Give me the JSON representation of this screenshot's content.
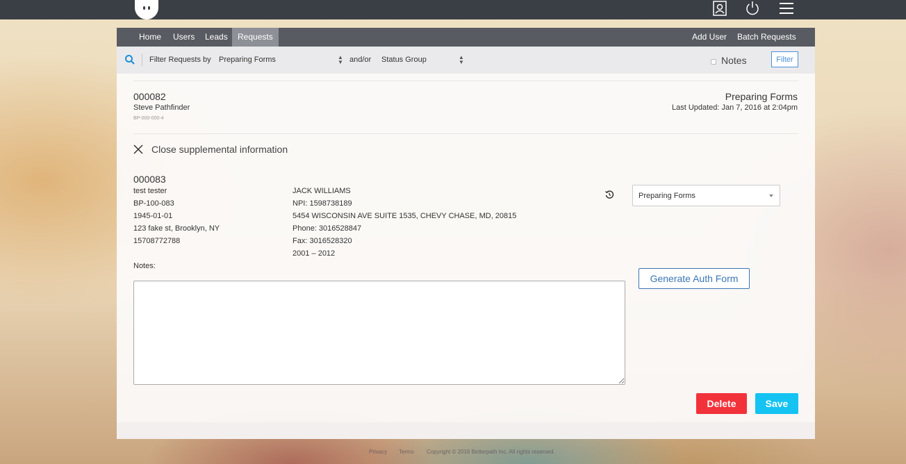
{
  "topbar": {
    "icons": [
      "logo-icon",
      "contact-card-icon",
      "power-icon",
      "menu-icon"
    ]
  },
  "nav": {
    "items": [
      "Home",
      "Users",
      "Leads",
      "Requests"
    ],
    "active": "Requests",
    "add_user": "Add User",
    "batch_requests": "Batch Requests"
  },
  "filter": {
    "label": "Filter Requests by",
    "request_status": "Preparing Forms",
    "andor": "and/or",
    "status_group": "Status Group",
    "notes_label": "Notes",
    "notes_checked": false,
    "filter_button": "Filter"
  },
  "request_summary": {
    "id": "000082",
    "name": "Steve Pathfinder",
    "code": "BP-000-000-4",
    "status": "Preparing Forms",
    "last_updated": "Last Updated: Jan 7, 2016 at 2:04pm"
  },
  "supplemental": {
    "close_label": "Close supplemental information",
    "id": "000083",
    "patient": {
      "name": "test tester",
      "code": "BP-100-083",
      "dob": "1945-01-01",
      "address": "123 fake st, Brooklyn, NY",
      "phone": "15708772788"
    },
    "provider": {
      "name": "JACK WILLIAMS",
      "npi": "NPI: 1598738189",
      "address": "5454 WISCONSIN AVE SUITE 1535, CHEVY CHASE, MD, 20815",
      "phone": "Phone: 3016528847",
      "fax": "Fax: 3016528320",
      "years": "2001 – 2012"
    },
    "status_select": "Preparing Forms",
    "notes_label": "Notes:",
    "notes_value": "",
    "generate_button": "Generate Auth Form",
    "delete_button": "Delete",
    "save_button": "Save"
  },
  "footer": {
    "privacy": "Privacy",
    "terms": "Terms",
    "copyright": "Copyright © 2016 Betterpath Inc. All rights reserved."
  },
  "colors": {
    "topbar": "#3a3e45",
    "navbar": "#585b61",
    "nav_active": "#8d9096",
    "accent_blue": "#3a75b5",
    "delete": "#f2323a",
    "save": "#14c3f2"
  }
}
